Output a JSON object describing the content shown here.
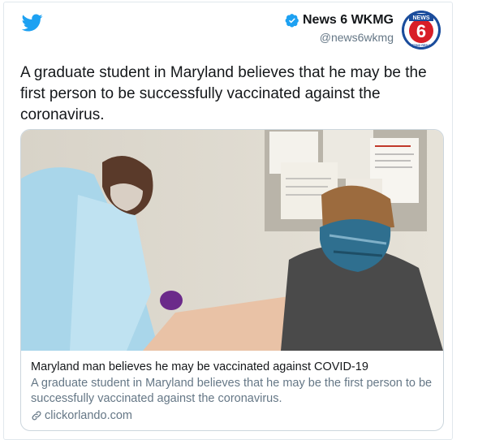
{
  "author": {
    "name": "News 6 WKMG",
    "handle": "@news6wkmg",
    "avatar_label_top": "NEWS",
    "avatar_label_num": "6",
    "avatar_label_bottom": "GETTING RESULTS"
  },
  "tweet": {
    "text": "A graduate student in Maryland believes that he may be the first person to be successfully vaccinated against the coronavirus."
  },
  "link_card": {
    "title": "Maryland man believes he may be vaccinated against COVID-19",
    "description": "A graduate student in Maryland believes that he may be the first person to be successfully vaccinated against the coronavirus.",
    "domain": "clickorlando.com"
  },
  "icons": {
    "brand": "twitter-bird-icon",
    "verified": "verified-badge-icon",
    "link": "link-icon"
  },
  "colors": {
    "twitter_blue": "#1da1f2",
    "text": "#14171a",
    "secondary_text": "#657786",
    "border": "#ccd6dd"
  }
}
